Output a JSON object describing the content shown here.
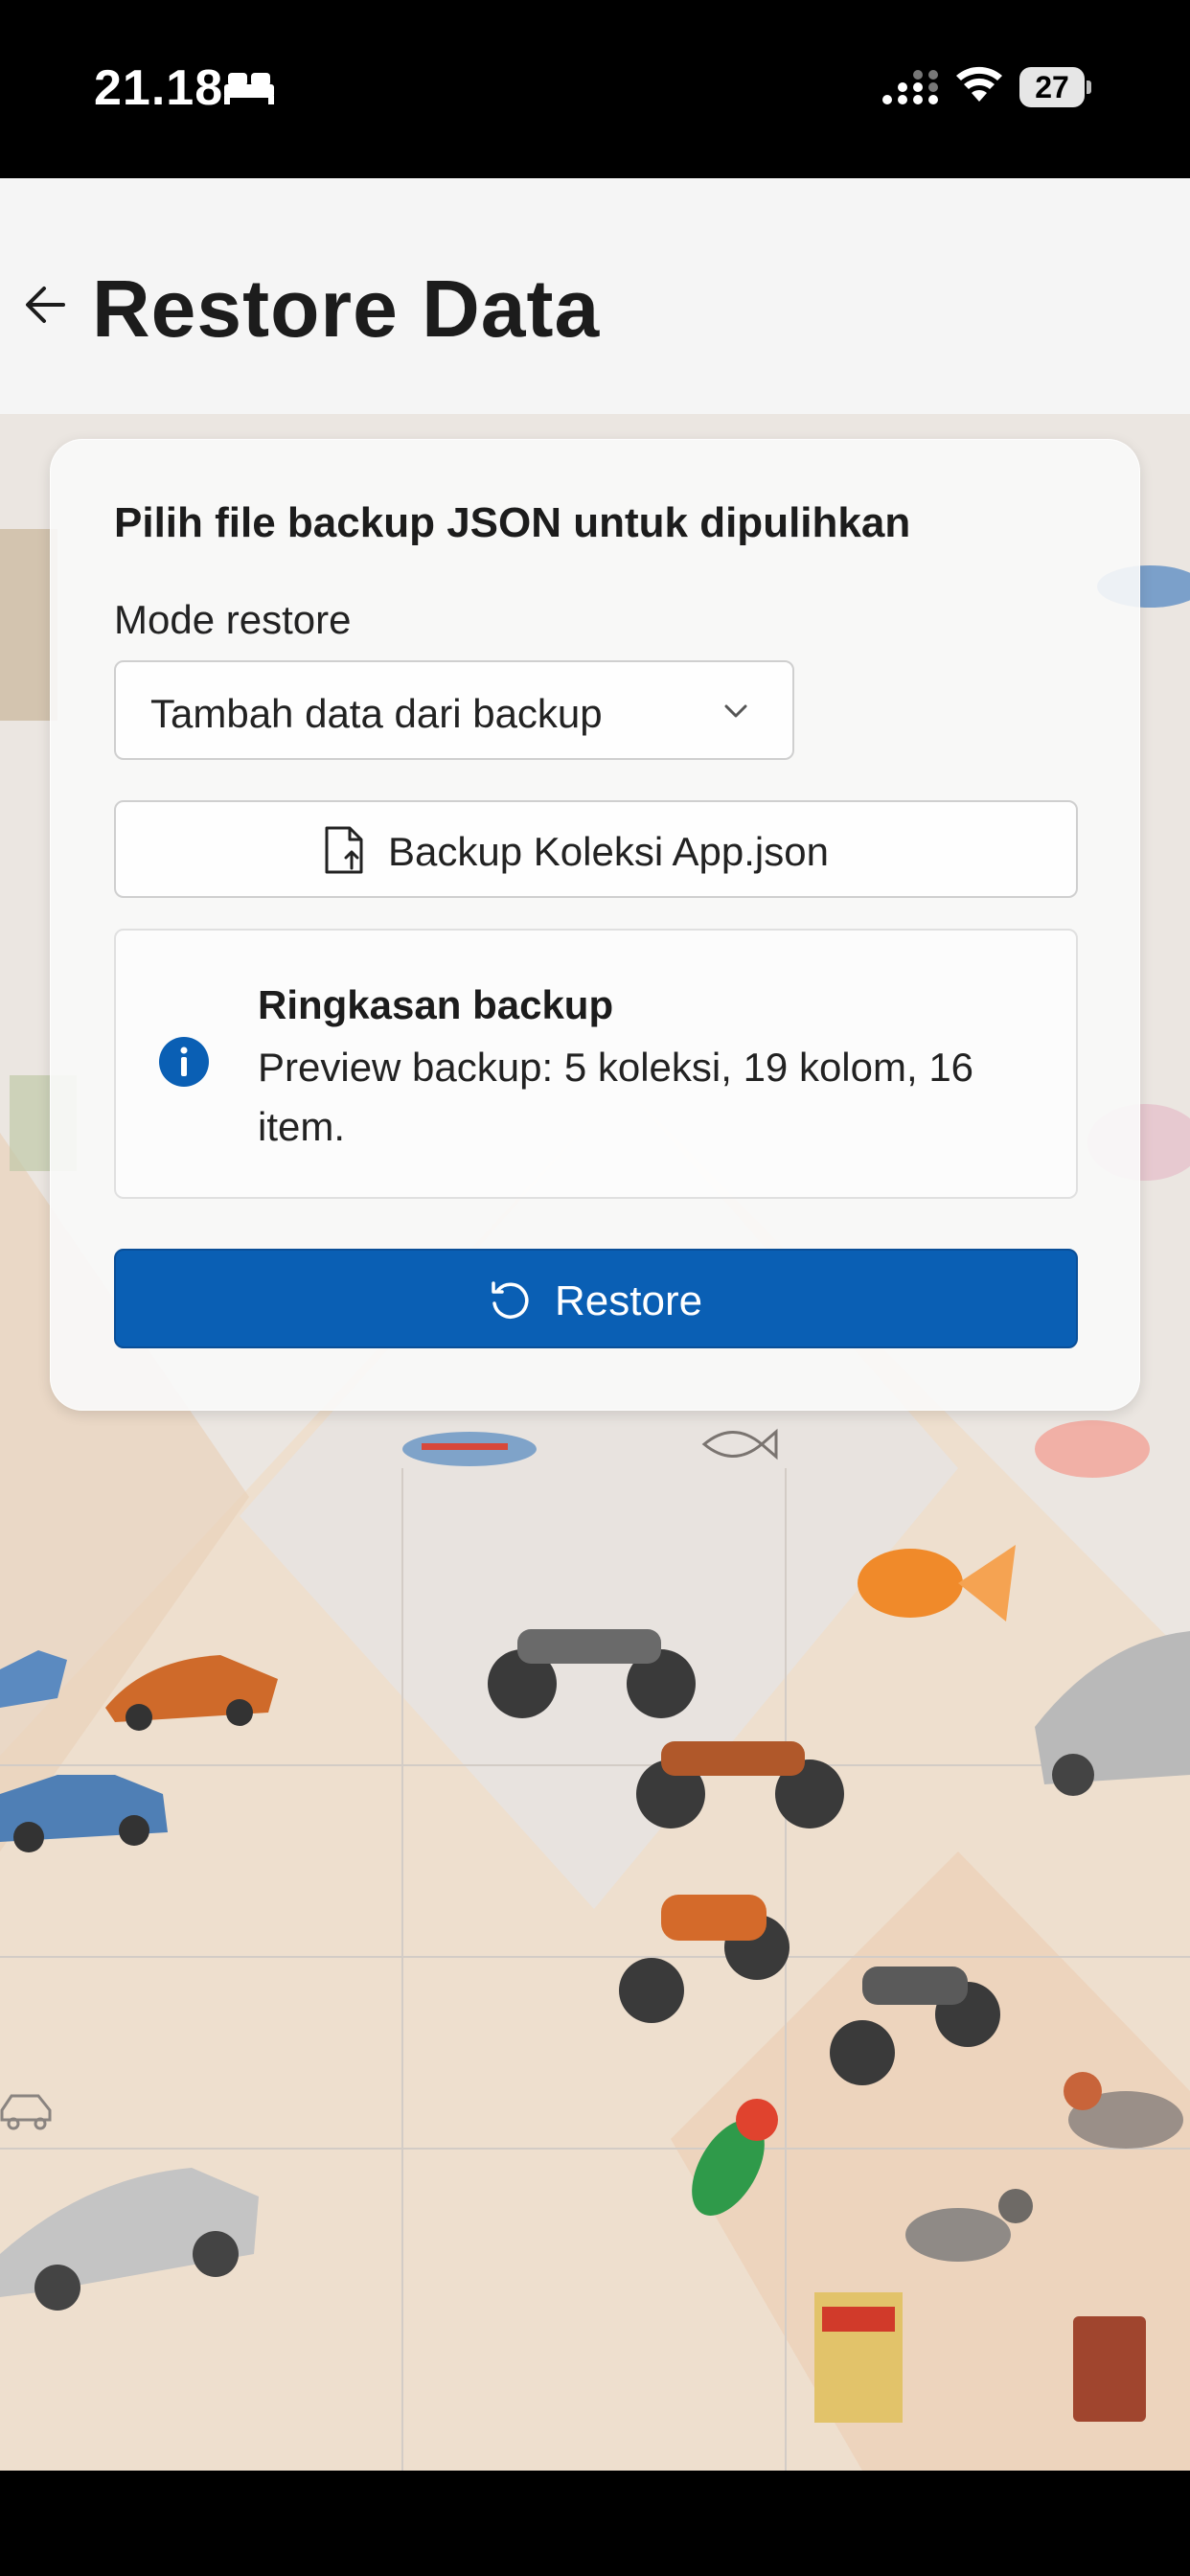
{
  "status_bar": {
    "time": "21.18",
    "battery": "27",
    "icons": [
      "bed-icon",
      "signal-icon",
      "wifi-icon",
      "battery-icon"
    ]
  },
  "app_bar": {
    "back_icon": "arrow-left-icon",
    "title": "Restore Data"
  },
  "card": {
    "heading": "Pilih file backup JSON untuk dipulihkan",
    "mode_label": "Mode restore",
    "mode_value": "Tambah data dari backup",
    "file_name": "Backup Koleksi App.json",
    "summary": {
      "title": "Ringkasan backup",
      "text": "Preview backup: 5 koleksi, 19 kolom, 16 item."
    },
    "restore_label": "Restore"
  },
  "colors": {
    "primary": "#0a5fb4",
    "status_bar": "#000000",
    "app_bar": "#f5f5f5",
    "card": "#fafafa"
  }
}
